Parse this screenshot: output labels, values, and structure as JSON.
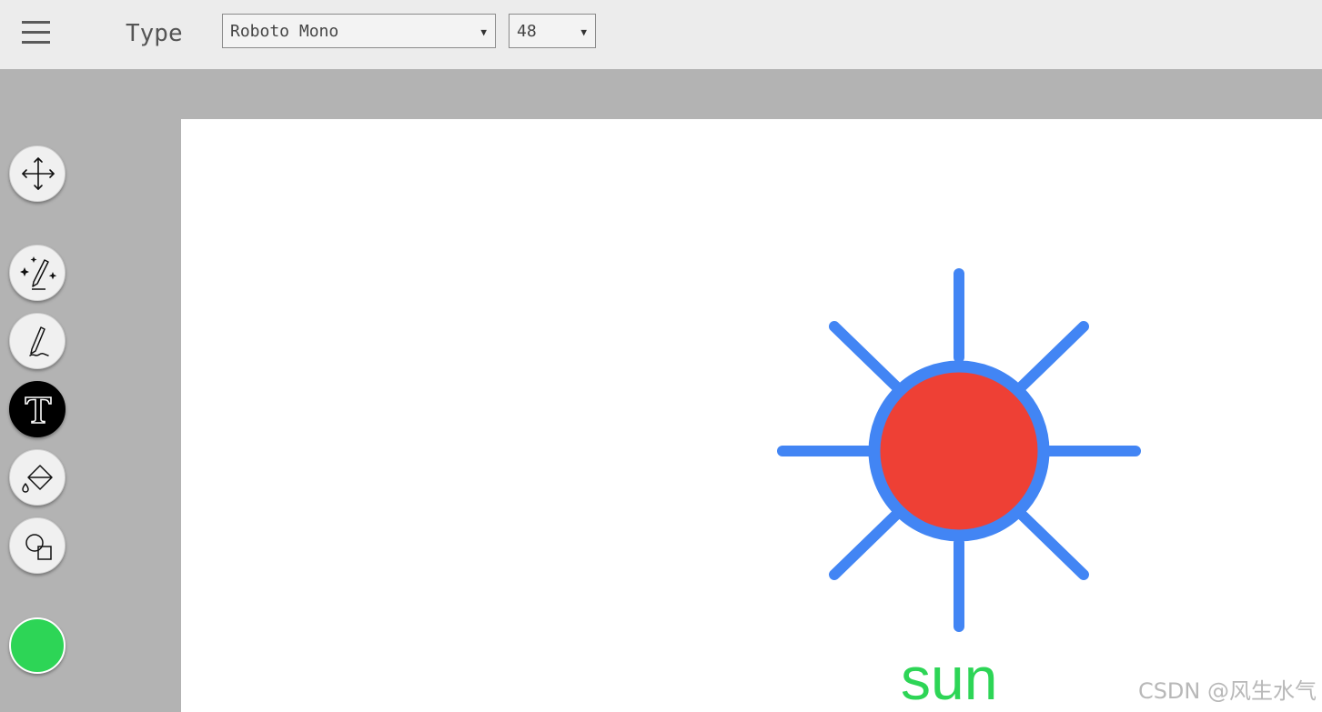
{
  "toolbar": {
    "mode_label": "Type",
    "font_family": "Roboto Mono",
    "font_size": "48"
  },
  "tools": [
    {
      "name": "move",
      "icon": "move-arrows-icon",
      "active": false
    },
    {
      "name": "magic-draw",
      "icon": "magic-pencil-sparkles-icon",
      "active": false
    },
    {
      "name": "pencil",
      "icon": "pencil-icon",
      "active": false
    },
    {
      "name": "type",
      "icon": "text-t-icon",
      "active": true
    },
    {
      "name": "fill",
      "icon": "paint-bucket-icon",
      "active": false
    },
    {
      "name": "shapes",
      "icon": "shapes-icon",
      "active": false
    }
  ],
  "current_color": "#2dd556",
  "canvas": {
    "text": "sun",
    "text_color": "#2dd556",
    "sun_fill_color": "#ee4035",
    "sun_stroke_color": "#4285f4"
  },
  "watermark": "CSDN @风生水气"
}
